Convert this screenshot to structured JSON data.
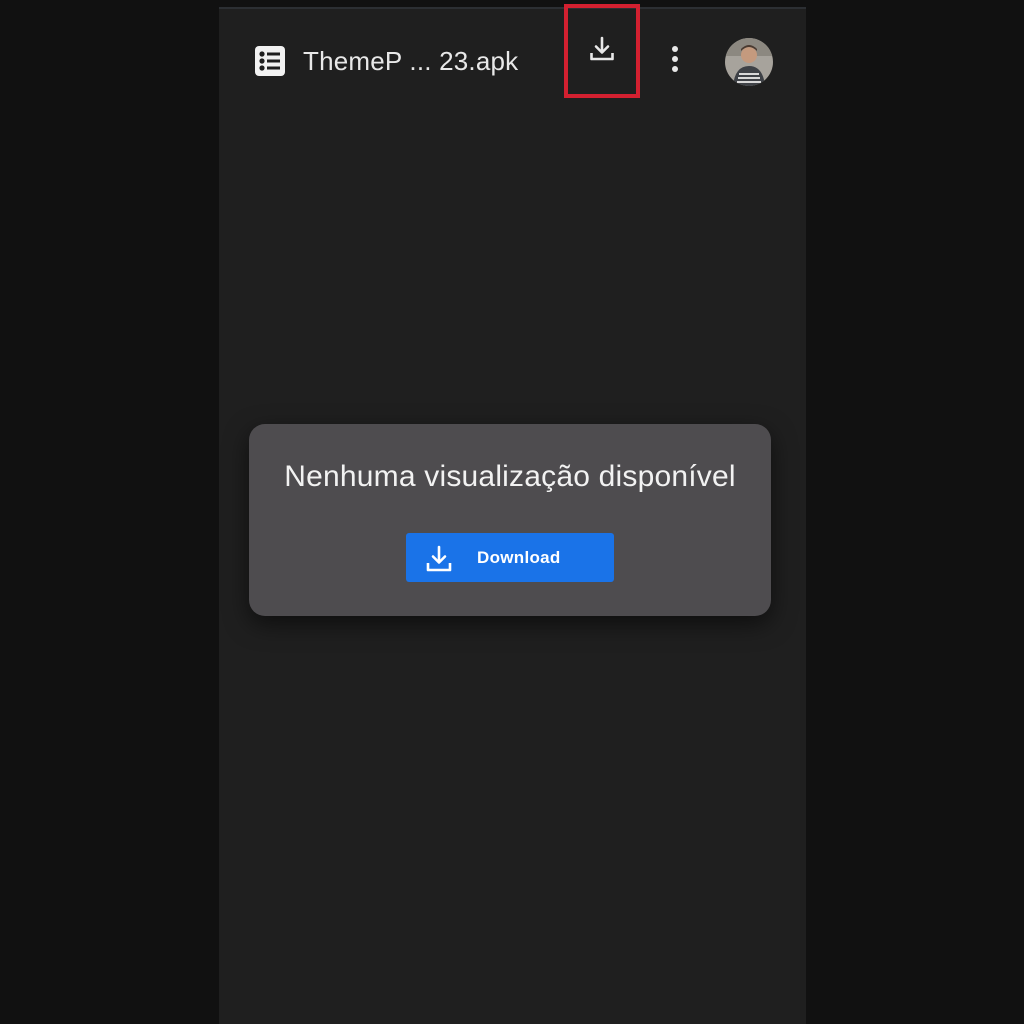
{
  "topbar": {
    "file_icon": "list-document-icon",
    "file_name": "ThemeP ... 23.apk",
    "download_icon": "download-icon",
    "more_icon": "more-vertical-icon",
    "avatar": "user-avatar"
  },
  "dialog": {
    "message": "Nenhuma visualização disponível",
    "button": {
      "icon": "download-icon",
      "label": "Download"
    }
  },
  "colors": {
    "page_background": "#111111",
    "viewer_background": "#1f1f1f",
    "dialog_background": "#4e4c4f",
    "primary_button": "#1a73e8",
    "highlight_box": "#d32030"
  }
}
